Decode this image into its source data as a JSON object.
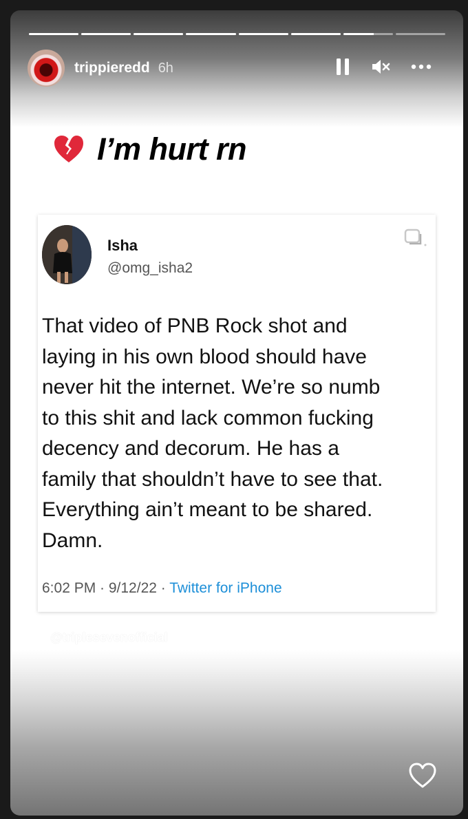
{
  "progress": [
    1,
    1,
    1,
    1,
    1,
    1,
    0.62,
    0
  ],
  "header": {
    "username": "trippieredd",
    "time": "6h",
    "icons": [
      "pause-icon",
      "mute-icon",
      "more-icon"
    ]
  },
  "caption": {
    "emoji": "broken-heart-icon",
    "text": "I’m hurt rn"
  },
  "tweet": {
    "name": "Isha",
    "handle": "@omg_isha2",
    "text": "That video of PNB Rock shot and\nlaying in his own blood should have\nnever hit the internet. We’re so numb\nto this shit and lack common fucking\ndecency and decorum. He has a\nfamily that shouldn’t have to see that.\nEverything ain’t meant to be shared.\nDamn.",
    "meta_time": "6:02 PM · 9/12/22 · ",
    "meta_source": "Twitter for iPhone"
  },
  "watermark": "@tripleseven​official",
  "colors": {
    "link": "#1d8fd8",
    "heart_emoji": "#e0283a"
  }
}
